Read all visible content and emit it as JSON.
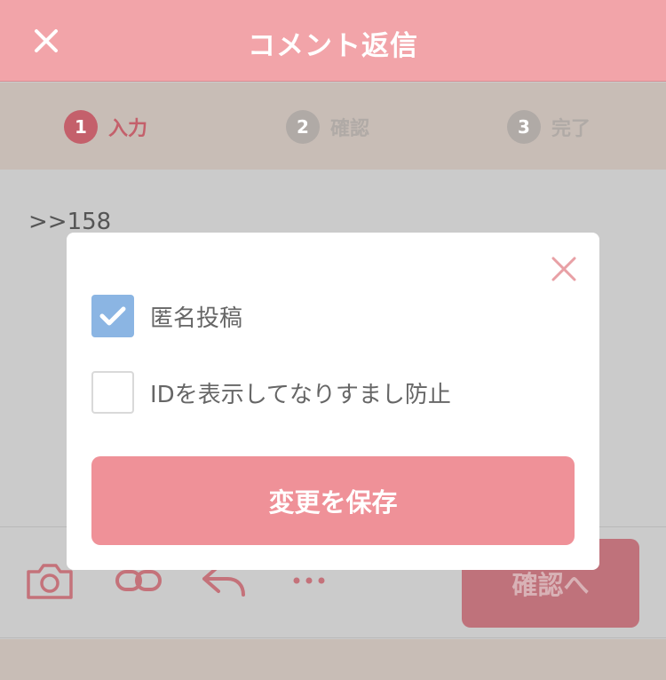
{
  "header": {
    "title": "コメント返信"
  },
  "steps": [
    {
      "num": "1",
      "label": "入力"
    },
    {
      "num": "2",
      "label": "確認"
    },
    {
      "num": "3",
      "label": "完了"
    }
  ],
  "compose": {
    "text": ">>158"
  },
  "toolbar": {
    "confirm_label": "確認へ"
  },
  "modal": {
    "options": [
      {
        "label": "匿名投稿",
        "checked": true
      },
      {
        "label": "IDを表示してなりすまし防止",
        "checked": false
      }
    ],
    "save_label": "変更を保存"
  },
  "colors": {
    "header": "#f2a4a9",
    "accent": "#c4606b",
    "save_button": "#ef9198",
    "checkbox": "#8bb5e3"
  }
}
